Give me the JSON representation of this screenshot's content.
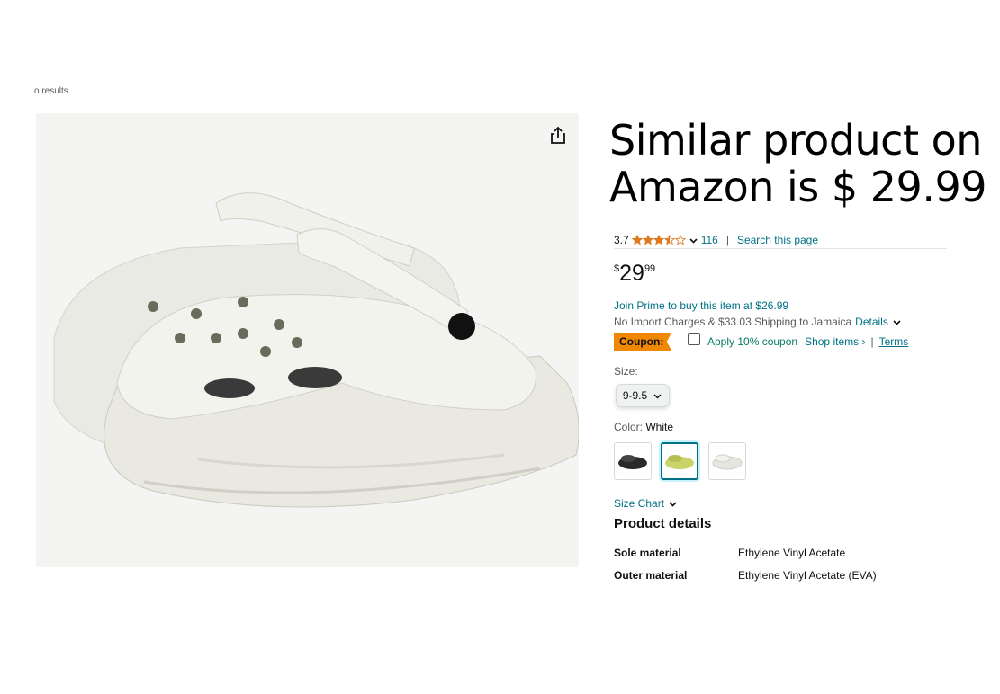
{
  "breadcrumb": "o results",
  "headline": "Similar product on Amazon is $ 29.99",
  "rating": {
    "value": "3.7",
    "stars": 3.5,
    "count": "116",
    "search_link": "Search this page"
  },
  "price": {
    "symbol": "$",
    "whole": "29",
    "fraction": "99"
  },
  "prime_text": "Join Prime to buy this item at $26.99",
  "import_text": "No Import Charges & $33.03 Shipping to Jamaica",
  "details_link": "Details",
  "coupon": {
    "badge": "Coupon:",
    "apply_text": "Apply 10% coupon",
    "shop_link": "Shop items ›",
    "separator": "|",
    "terms": "Terms"
  },
  "size": {
    "label": "Size:",
    "selected": "9-9.5"
  },
  "color": {
    "label": "Color:",
    "selected": "White",
    "swatches": [
      {
        "name": "black",
        "fill": "#2a2a2a"
      },
      {
        "name": "green",
        "fill": "#c9d36a"
      },
      {
        "name": "white",
        "fill": "#e6e6e1"
      }
    ]
  },
  "size_chart": "Size Chart",
  "product_details": {
    "title": "Product details",
    "rows": [
      {
        "key": "Sole material",
        "value": "Ethylene Vinyl Acetate"
      },
      {
        "key": "Outer material",
        "value": "Ethylene Vinyl Acetate (EVA)"
      }
    ]
  },
  "colors": {
    "link": "#007185",
    "star": "#de7921",
    "coupon_badge": "#f08804",
    "coupon_text": "#067d62"
  }
}
